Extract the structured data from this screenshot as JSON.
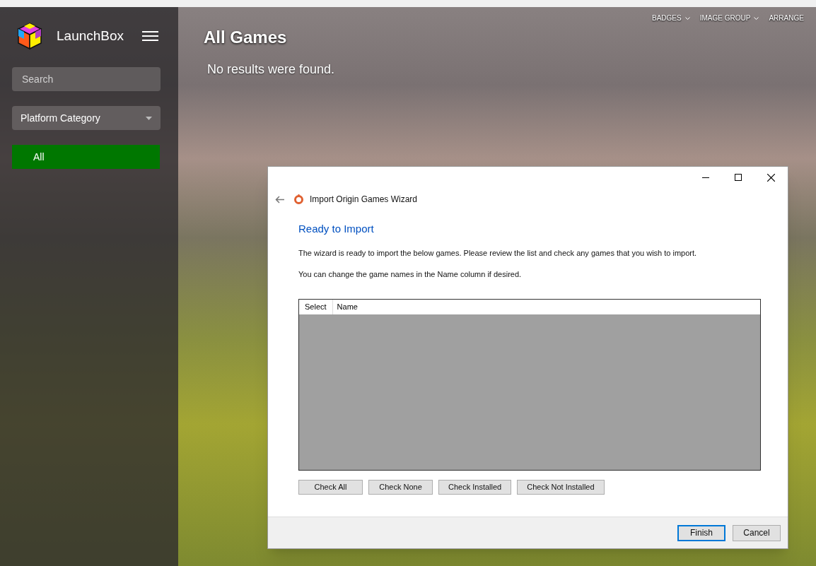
{
  "app": {
    "title": "LaunchBox"
  },
  "sidebar": {
    "search": {
      "placeholder": "Search"
    },
    "filter": {
      "value": "Platform Category"
    },
    "items": [
      {
        "label": "All",
        "selected": true
      }
    ]
  },
  "top_menu": [
    {
      "label": "BADGES"
    },
    {
      "label": "IMAGE GROUP"
    },
    {
      "label": "ARRANGE"
    }
  ],
  "main": {
    "title": "All Games",
    "message": "No results were found."
  },
  "dialog": {
    "title": "Import Origin Games Wizard",
    "heading": "Ready to Import",
    "paragraphs": [
      "The wizard is ready to import the below games. Please review the list and check any games that you wish to import.",
      "You can change the game names in the Name column if desired."
    ],
    "table": {
      "columns": [
        "Select",
        "Name"
      ]
    },
    "check_buttons": [
      "Check All",
      "Check None",
      "Check Installed",
      "Check Not Installed"
    ],
    "footer_buttons": [
      {
        "label": "Finish",
        "default": true
      },
      {
        "label": "Cancel",
        "default": false
      }
    ]
  }
}
